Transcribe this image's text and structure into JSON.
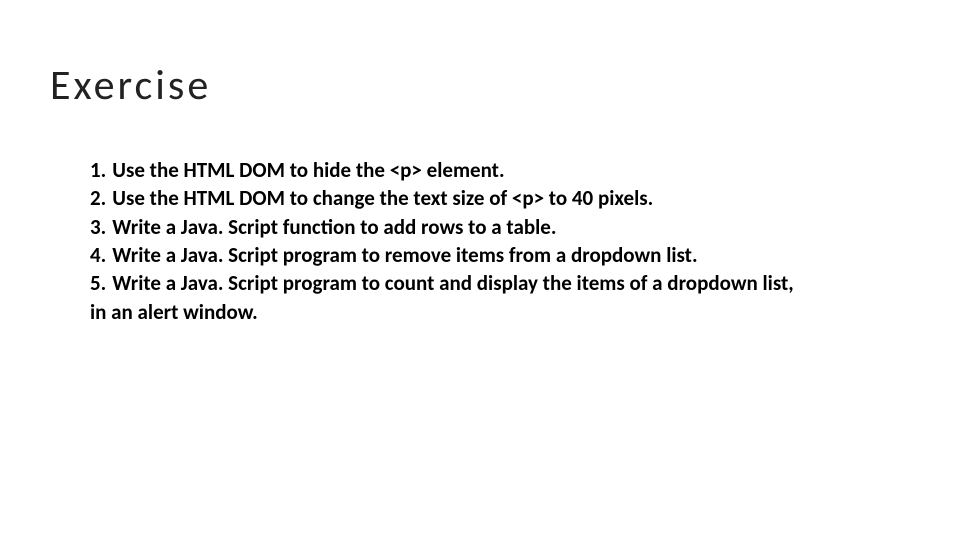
{
  "title": "Exercise",
  "items": [
    {
      "num": "1.",
      "text": "Use the HTML DOM to hide the <p> element."
    },
    {
      "num": "2.",
      "text": "Use the HTML DOM to change the text size of <p> to 40 pixels."
    },
    {
      "num": "3.",
      "text": "Write a Java. Script function to add rows to a table."
    },
    {
      "num": "4.",
      "text": "Write a Java. Script program to remove items from a dropdown list."
    },
    {
      "num": "5.",
      "text": "Write a Java. Script program to count and display the items of a dropdown list,"
    }
  ],
  "continuation": " in an alert window."
}
